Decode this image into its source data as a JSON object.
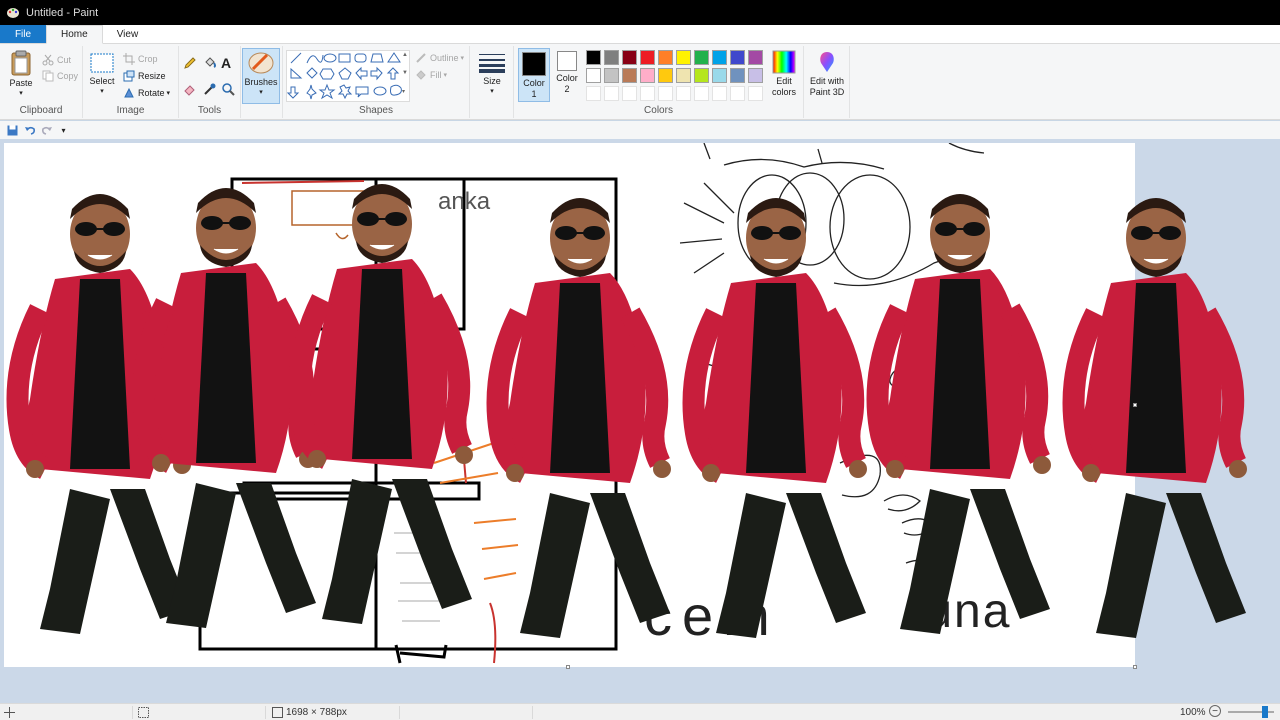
{
  "window": {
    "title": "Untitled - Paint"
  },
  "tabs": {
    "file": "File",
    "home": "Home",
    "view": "View"
  },
  "clipboard": {
    "paste": "Paste",
    "cut": "Cut",
    "copy": "Copy",
    "label": "Clipboard"
  },
  "image": {
    "select": "Select",
    "crop": "Crop",
    "resize": "Resize",
    "rotate": "Rotate",
    "label": "Image"
  },
  "tools": {
    "label": "Tools",
    "text_tool": "A"
  },
  "brushes": {
    "label": "Brushes"
  },
  "shapes": {
    "outline": "Outline",
    "fill": "Fill",
    "label": "Shapes"
  },
  "size": {
    "label": "Size"
  },
  "colors": {
    "color1": "Color\n1",
    "color2": "Color\n2",
    "color1_value": "#000000",
    "color2_value": "#ffffff",
    "edit_colors": "Edit\ncolors",
    "edit_paint3d": "Edit with\nPaint 3D",
    "label": "Colors",
    "palette_row1": [
      "#000000",
      "#7f7f7f",
      "#880015",
      "#ed1c24",
      "#ff7f27",
      "#fff200",
      "#22b14c",
      "#00a2e8",
      "#3f48cc",
      "#a349a4"
    ],
    "palette_row2": [
      "#ffffff",
      "#c3c3c3",
      "#b97a57",
      "#ffaec9",
      "#ffc90e",
      "#efe4b0",
      "#b5e61d",
      "#99d9ea",
      "#7092be",
      "#c8bfe7"
    ]
  },
  "canvas": {
    "drawing_text": "anka",
    "bottom_text_1": "cem",
    "bottom_text_2": "tuna"
  },
  "status": {
    "dimensions": "1698 × 788px",
    "zoom": "100%"
  }
}
